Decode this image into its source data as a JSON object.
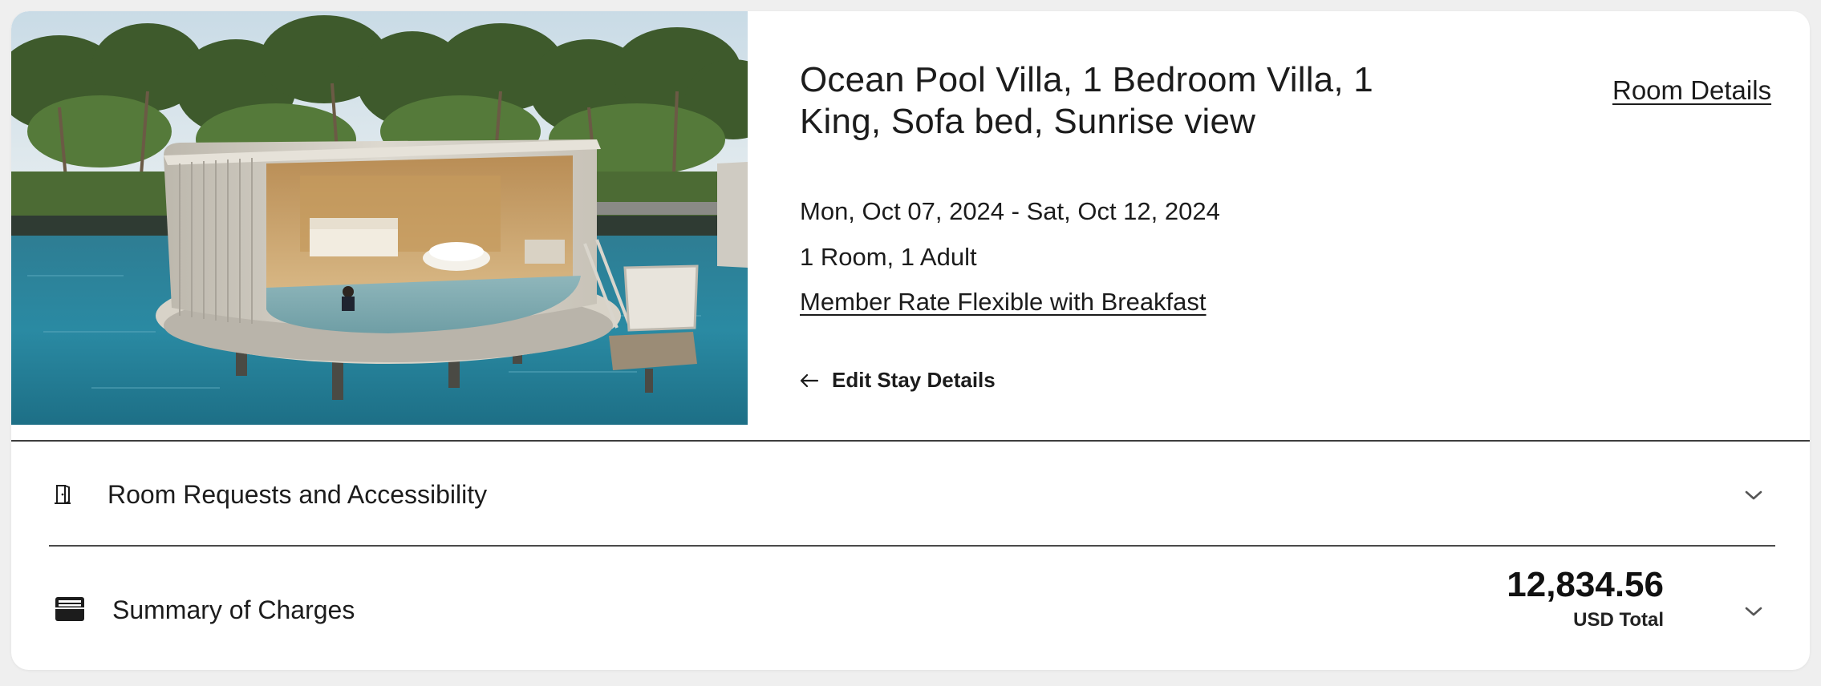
{
  "room": {
    "title": "Ocean Pool Villa, 1 Bedroom Villa, 1 King, Sofa bed, Sunrise view",
    "details_link": "Room Details",
    "image_icon": "villa-photo"
  },
  "stay": {
    "dates": "Mon, Oct 07, 2024 - Sat, Oct 12, 2024",
    "occupancy": "1 Room, 1 Adult",
    "rate": "Member Rate Flexible with Breakfast",
    "edit_label": "Edit Stay Details",
    "edit_icon": "arrow-left-icon"
  },
  "sections": {
    "requests": {
      "label": "Room Requests and Accessibility",
      "icon": "door-icon",
      "toggle_icon": "chevron-down-icon"
    },
    "charges": {
      "label": "Summary of Charges",
      "icon": "wallet-icon",
      "toggle_icon": "chevron-down-icon",
      "total": "12,834.56",
      "total_caption": "USD Total"
    }
  },
  "colors": {
    "background": "#efefef",
    "card": "#ffffff",
    "text": "#1c1c1c",
    "divider": "#3d3d3d"
  }
}
